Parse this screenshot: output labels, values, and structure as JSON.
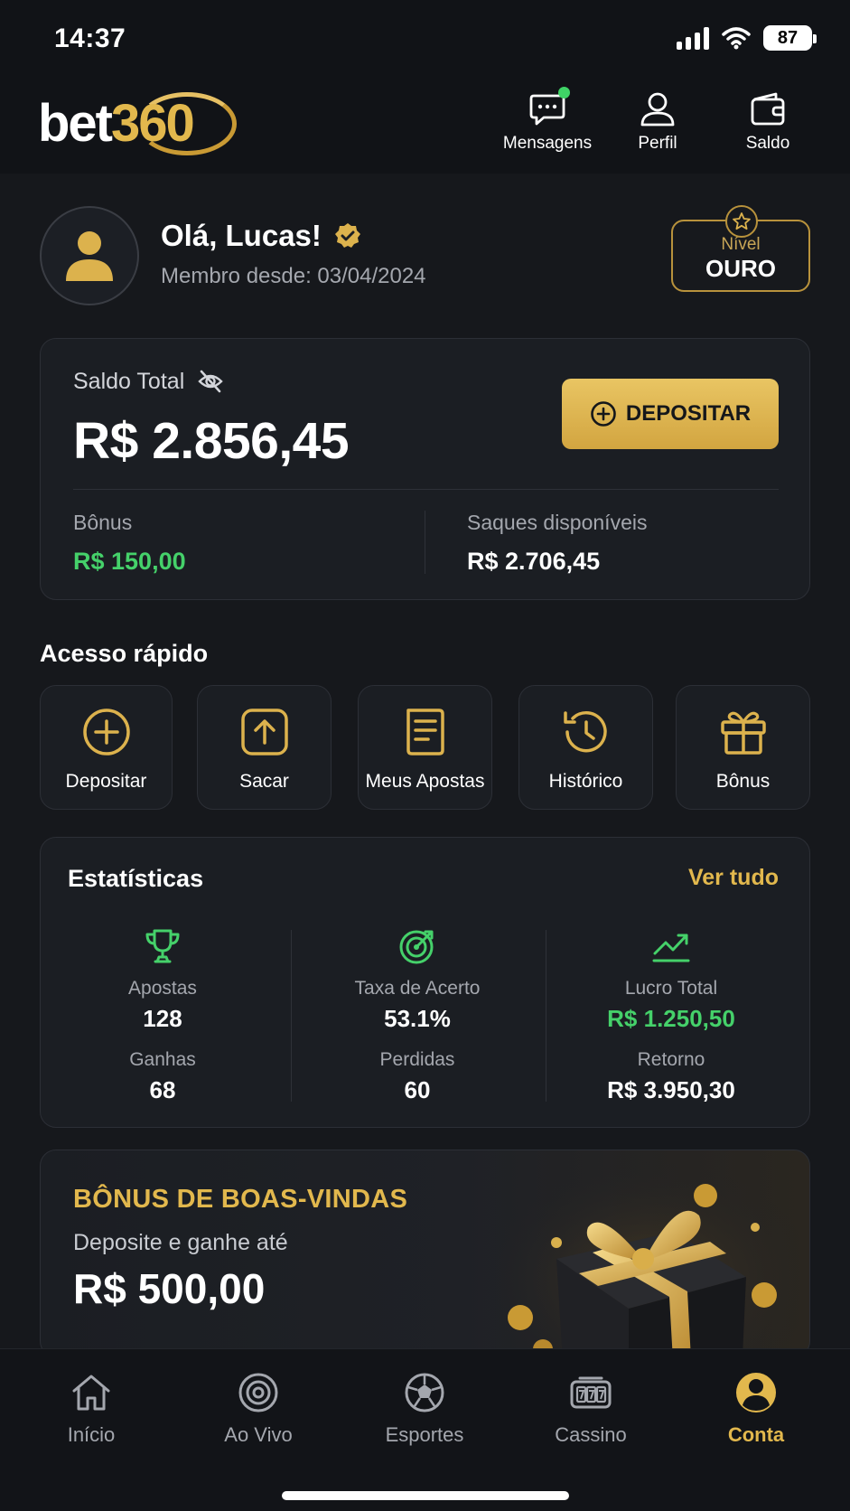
{
  "status_bar": {
    "time": "14:37",
    "battery": "87"
  },
  "header": {
    "logo_word": "bet",
    "logo_number": "360",
    "actions": [
      {
        "label": "Mensagens",
        "icon": "chat-icon",
        "has_notification": true
      },
      {
        "label": "Perfil",
        "icon": "user-icon"
      },
      {
        "label": "Saldo",
        "icon": "wallet-icon"
      }
    ]
  },
  "profile": {
    "greeting": "Olá, Lucas!",
    "member_since": "Membro desde: 03/04/2024",
    "level_label": "Nível",
    "level_value": "OURO"
  },
  "balance": {
    "label": "Saldo Total",
    "value": "R$ 2.856,45",
    "deposit_label": "DEPOSITAR",
    "bonus_label": "Bônus",
    "bonus_value": "R$ 150,00",
    "withdraw_label": "Saques disponíveis",
    "withdraw_value": "R$ 2.706,45"
  },
  "quick_access": {
    "title": "Acesso rápido",
    "items": [
      {
        "label": "Depositar",
        "icon": "plus-circle-icon"
      },
      {
        "label": "Sacar",
        "icon": "upload-icon"
      },
      {
        "label": "Meus Apostas",
        "icon": "receipt-icon"
      },
      {
        "label": "Histórico",
        "icon": "history-icon"
      },
      {
        "label": "Bônus",
        "icon": "gift-icon"
      }
    ]
  },
  "stats": {
    "title": "Estatísticas",
    "see_all": "Ver tudo",
    "columns": [
      {
        "icon": "trophy-icon",
        "label": "Apostas",
        "value": "128",
        "label2": "Ganhas",
        "value2": "68"
      },
      {
        "icon": "target-icon",
        "label": "Taxa de Acerto",
        "value": "53.1%",
        "label2": "Perdidas",
        "value2": "60"
      },
      {
        "icon": "trend-up-icon",
        "label": "Lucro Total",
        "value": "R$ 1.250,50",
        "label2": "Retorno",
        "value2": "R$ 3.950,30"
      }
    ]
  },
  "promo": {
    "title": "BÔNUS DE BOAS-VINDAS",
    "subtitle": "Deposite e ganhe até",
    "amount": "R$ 500,00"
  },
  "bottom_nav": {
    "items": [
      {
        "label": "Início",
        "icon": "home-icon"
      },
      {
        "label": "Ao Vivo",
        "icon": "live-icon"
      },
      {
        "label": "Esportes",
        "icon": "soccer-ball-icon"
      },
      {
        "label": "Cassino",
        "icon": "slot-machine-icon"
      },
      {
        "label": "Conta",
        "icon": "account-icon",
        "active": true
      }
    ]
  },
  "colors": {
    "accent_gold": "#e2b84d",
    "positive_green": "#45d16a",
    "background": "#16181c",
    "card": "#1b1e23"
  }
}
